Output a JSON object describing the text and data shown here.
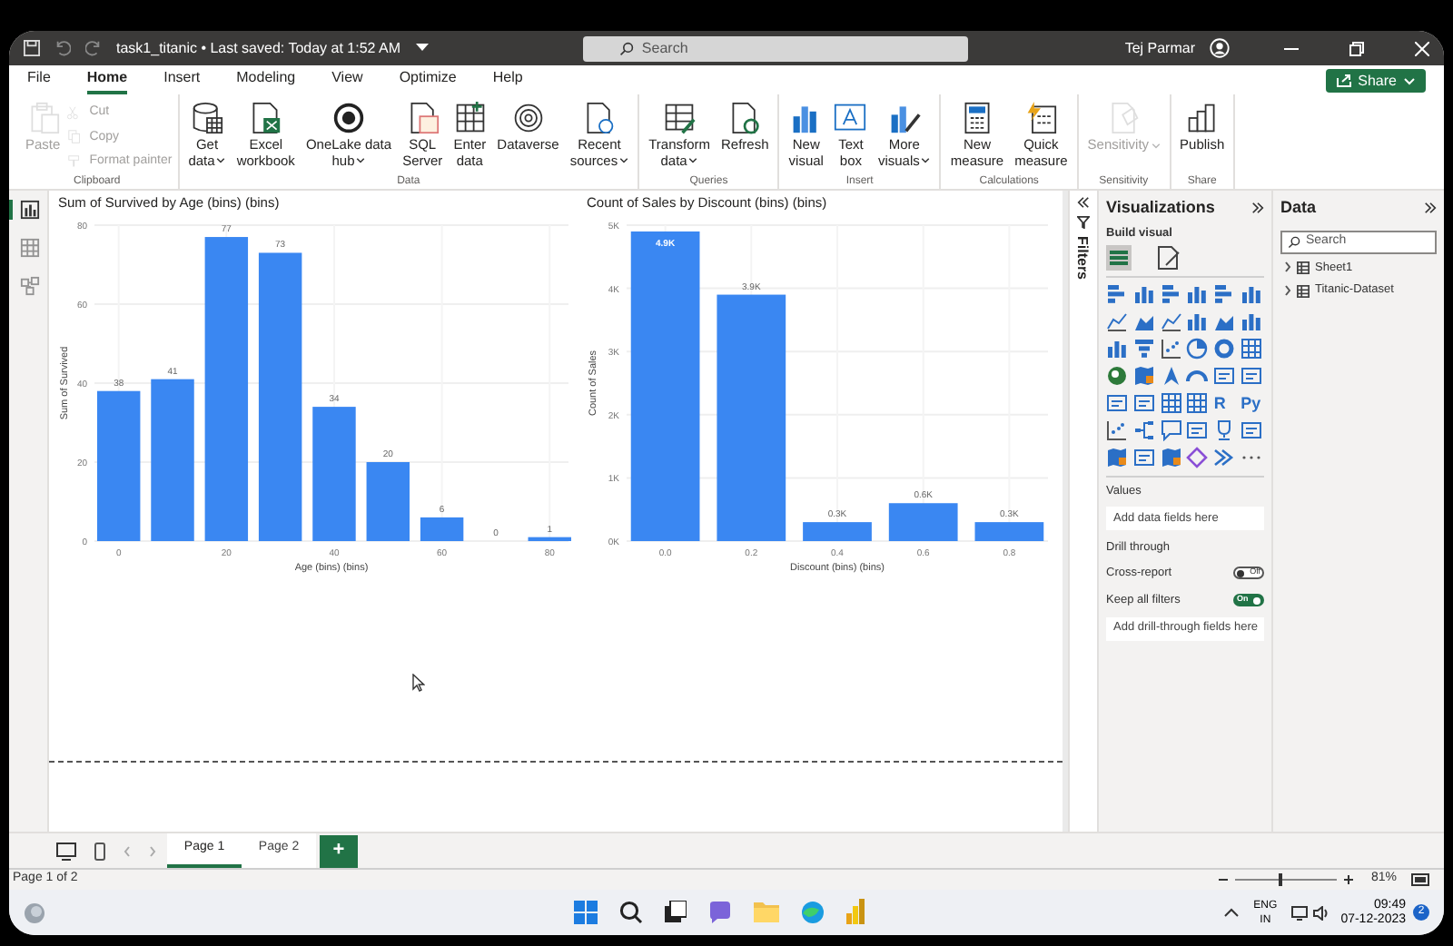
{
  "window": {
    "title": "task1_titanic • Last saved: Today at 1:52 AM",
    "search_placeholder": "Search",
    "user": "Tej Parmar"
  },
  "menu_tabs": [
    {
      "label": "File",
      "selected": false
    },
    {
      "label": "Home",
      "selected": true
    },
    {
      "label": "Insert",
      "selected": false
    },
    {
      "label": "Modeling",
      "selected": false
    },
    {
      "label": "View",
      "selected": false
    },
    {
      "label": "Optimize",
      "selected": false
    },
    {
      "label": "Help",
      "selected": false
    }
  ],
  "share_button": "Share",
  "ribbon": [
    {
      "name": "Clipboard",
      "items": [
        {
          "kind": "large",
          "lines": [
            "Paste"
          ],
          "disabled": true,
          "dropdown": false
        },
        {
          "kind": "small",
          "lines": [
            "Cut"
          ],
          "disabled": true
        },
        {
          "kind": "small",
          "lines": [
            "Copy"
          ],
          "disabled": true
        },
        {
          "kind": "small",
          "lines": [
            "Format painter"
          ],
          "disabled": true
        }
      ]
    },
    {
      "name": "Data",
      "items": [
        {
          "kind": "large",
          "lines": [
            "Get",
            "data"
          ],
          "disabled": false,
          "dropdown": true
        },
        {
          "kind": "large",
          "lines": [
            "Excel",
            "workbook"
          ],
          "disabled": false,
          "dropdown": false
        },
        {
          "kind": "large",
          "lines": [
            "OneLake data",
            "hub"
          ],
          "disabled": false,
          "dropdown": true
        },
        {
          "kind": "large",
          "lines": [
            "SQL",
            "Server"
          ],
          "disabled": false,
          "dropdown": false
        },
        {
          "kind": "large",
          "lines": [
            "Enter",
            "data"
          ],
          "disabled": false,
          "dropdown": false
        },
        {
          "kind": "large",
          "lines": [
            "Dataverse"
          ],
          "disabled": false,
          "dropdown": false
        },
        {
          "kind": "large",
          "lines": [
            "Recent",
            "sources"
          ],
          "disabled": false,
          "dropdown": true
        }
      ]
    },
    {
      "name": "Queries",
      "items": [
        {
          "kind": "large",
          "lines": [
            "Transform",
            "data"
          ],
          "disabled": false,
          "dropdown": true
        },
        {
          "kind": "large",
          "lines": [
            "Refresh"
          ],
          "disabled": false,
          "dropdown": false
        }
      ]
    },
    {
      "name": "Insert",
      "items": [
        {
          "kind": "large",
          "lines": [
            "New",
            "visual"
          ],
          "disabled": false,
          "dropdown": false
        },
        {
          "kind": "large",
          "lines": [
            "Text",
            "box"
          ],
          "disabled": false,
          "dropdown": false
        },
        {
          "kind": "large",
          "lines": [
            "More",
            "visuals"
          ],
          "disabled": false,
          "dropdown": true
        }
      ]
    },
    {
      "name": "Calculations",
      "items": [
        {
          "kind": "large",
          "lines": [
            "New",
            "measure"
          ],
          "disabled": false,
          "dropdown": false
        },
        {
          "kind": "large",
          "lines": [
            "Quick",
            "measure"
          ],
          "disabled": false,
          "dropdown": false
        }
      ]
    },
    {
      "name": "Sensitivity",
      "items": [
        {
          "kind": "large",
          "lines": [
            "Sensitivity"
          ],
          "disabled": true,
          "dropdown": true
        }
      ]
    },
    {
      "name": "Share",
      "items": [
        {
          "kind": "large",
          "lines": [
            "Publish"
          ],
          "disabled": false,
          "dropdown": false
        }
      ]
    }
  ],
  "nav_views": [
    {
      "selected": true
    },
    {
      "selected": false
    },
    {
      "selected": false
    }
  ],
  "charts": [
    {
      "chart_data": {
        "type": "bar",
        "title": "Sum of Survived by Age (bins) (bins)",
        "xlabel": "Age (bins) (bins)",
        "ylabel": "Sum of Survived",
        "x": [
          0,
          10,
          20,
          30,
          40,
          50,
          60,
          70,
          80
        ],
        "values": [
          38,
          41,
          77,
          73,
          34,
          20,
          6,
          0,
          1
        ],
        "xlim": [
          -4.5,
          83.5
        ],
        "ylim": [
          0,
          80
        ],
        "xticks": [
          0,
          20,
          40,
          60,
          80
        ],
        "yticks": [
          0,
          20,
          40,
          60,
          80
        ],
        "grid": true,
        "value_labels": [
          "38",
          "41",
          "77",
          "73",
          "34",
          "20",
          "6",
          "0",
          "1"
        ]
      }
    },
    {
      "chart_data": {
        "type": "bar",
        "title": "Count of Sales by Discount (bins) (bins)",
        "xlabel": "Discount (bins) (bins)",
        "ylabel": "Count of Sales",
        "x": [
          0,
          0.2,
          0.4,
          0.6,
          0.8
        ],
        "values": [
          4900,
          3900,
          300,
          600,
          300
        ],
        "xlim": [
          -0.09,
          0.89
        ],
        "ylim": [
          0,
          5000
        ],
        "xticks": [
          {
            "value": 0,
            "label": "0.0"
          },
          {
            "value": 0.2,
            "label": "0.2"
          },
          {
            "value": 0.4,
            "label": "0.4"
          },
          {
            "value": 0.6,
            "label": "0.6"
          },
          {
            "value": 0.8,
            "label": "0.8"
          }
        ],
        "yticks": [
          {
            "value": 0,
            "label": "0K"
          },
          {
            "value": 1000,
            "label": "1K"
          },
          {
            "value": 2000,
            "label": "2K"
          },
          {
            "value": 3000,
            "label": "3K"
          },
          {
            "value": 4000,
            "label": "4K"
          },
          {
            "value": 5000,
            "label": "5K"
          }
        ],
        "grid": true,
        "value_labels": [
          "4.9K",
          "3.9K",
          "0.3K",
          "0.6K",
          "0.3K"
        ]
      }
    }
  ],
  "filters_label": "Filters",
  "visualizations": {
    "title": "Visualizations",
    "build_visual": "Build visual",
    "visual_types": [
      {
        "kind": "hbar"
      },
      {
        "kind": "bar"
      },
      {
        "kind": "hbar"
      },
      {
        "kind": "bar"
      },
      {
        "kind": "hbar"
      },
      {
        "kind": "bar"
      },
      {
        "kind": "line"
      },
      {
        "kind": "area"
      },
      {
        "kind": "line"
      },
      {
        "kind": "bar"
      },
      {
        "kind": "area"
      },
      {
        "kind": "bar"
      },
      {
        "kind": "bar"
      },
      {
        "kind": "funnel"
      },
      {
        "kind": "scatter"
      },
      {
        "kind": "pie"
      },
      {
        "kind": "donut"
      },
      {
        "kind": "grid"
      },
      {
        "kind": "globe"
      },
      {
        "kind": "map"
      },
      {
        "kind": "arrow"
      },
      {
        "kind": "gauge"
      },
      {
        "kind": "card"
      },
      {
        "kind": "card"
      },
      {
        "kind": "card"
      },
      {
        "kind": "card"
      },
      {
        "kind": "grid"
      },
      {
        "kind": "grid"
      },
      {
        "kind": "text",
        "text": "R"
      },
      {
        "kind": "text",
        "text": "Py"
      },
      {
        "kind": "scatter"
      },
      {
        "kind": "tree"
      },
      {
        "kind": "bubble"
      },
      {
        "kind": "card"
      },
      {
        "kind": "trophy"
      },
      {
        "kind": "card"
      },
      {
        "kind": "map"
      },
      {
        "kind": "card"
      },
      {
        "kind": "map"
      },
      {
        "kind": "diamond"
      },
      {
        "kind": "chevron"
      },
      {
        "kind": "more"
      }
    ],
    "values_label": "Values",
    "values_placeholder": "Add data fields here",
    "drill_title": "Drill through",
    "toggles": [
      {
        "label": "Cross-report",
        "on": false,
        "state_text": "Off"
      },
      {
        "label": "Keep all filters",
        "on": true,
        "state_text": "On"
      }
    ],
    "drill_placeholder": "Add drill-through fields here"
  },
  "data_pane": {
    "title": "Data",
    "search_placeholder": "Search",
    "tables": [
      {
        "name": "Sheet1",
        "expanded": false
      },
      {
        "name": "Titanic-Dataset",
        "expanded": false
      }
    ]
  },
  "pages": [
    {
      "label": "Page 1",
      "selected": true
    },
    {
      "label": "Page 2",
      "selected": false
    }
  ],
  "add_page": "+",
  "status_bar": {
    "page_info": "Page 1 of 2",
    "zoom": {
      "level": 0.45
    },
    "zoom_text": "81%"
  },
  "taskbar": {
    "language": "ENG",
    "region": "IN",
    "time": "09:49",
    "date": "07-12-2023",
    "notifications": "2"
  }
}
